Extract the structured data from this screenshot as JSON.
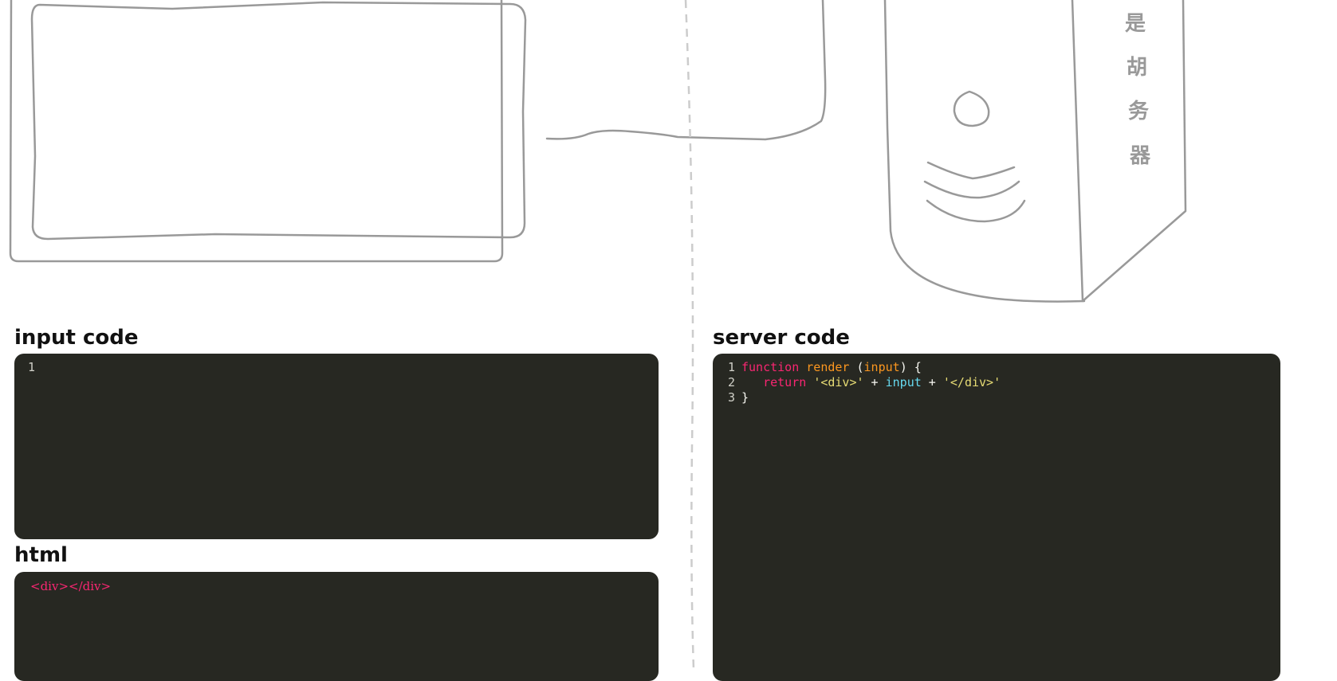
{
  "colors": {
    "editor_bg": "#272822",
    "line_number": "#d0d0c8",
    "keyword": "#f92672",
    "function_name": "#fd971f",
    "string": "#e6db74",
    "identifier": "#66d9ef",
    "sketch_stroke": "#999999"
  },
  "illustration": {
    "monitor_icon": "monitor-sketch-icon",
    "server_icon": "server-sketch-icon",
    "server_label_chars": [
      "是",
      "胡",
      "务",
      "器"
    ]
  },
  "input_panel": {
    "title": "input code",
    "lines": [
      {
        "number": "1",
        "text": ""
      }
    ]
  },
  "html_panel": {
    "title": "html",
    "output": "<div></div>"
  },
  "server_panel": {
    "title": "server code",
    "lines": [
      {
        "number": "1",
        "tokens": [
          {
            "t": "function",
            "c": "kw"
          },
          {
            "t": " ",
            "c": "plain"
          },
          {
            "t": "render",
            "c": "fn"
          },
          {
            "t": " (",
            "c": "plain"
          },
          {
            "t": "input",
            "c": "fn"
          },
          {
            "t": ") {",
            "c": "plain"
          }
        ]
      },
      {
        "number": "2",
        "tokens": [
          {
            "t": "   ",
            "c": "plain"
          },
          {
            "t": "return",
            "c": "kw"
          },
          {
            "t": " ",
            "c": "plain"
          },
          {
            "t": "'<div>'",
            "c": "str"
          },
          {
            "t": " + ",
            "c": "plain"
          },
          {
            "t": "input",
            "c": "id"
          },
          {
            "t": " + ",
            "c": "plain"
          },
          {
            "t": "'</div>'",
            "c": "str"
          }
        ]
      },
      {
        "number": "3",
        "tokens": [
          {
            "t": "}",
            "c": "plain"
          }
        ]
      }
    ]
  }
}
